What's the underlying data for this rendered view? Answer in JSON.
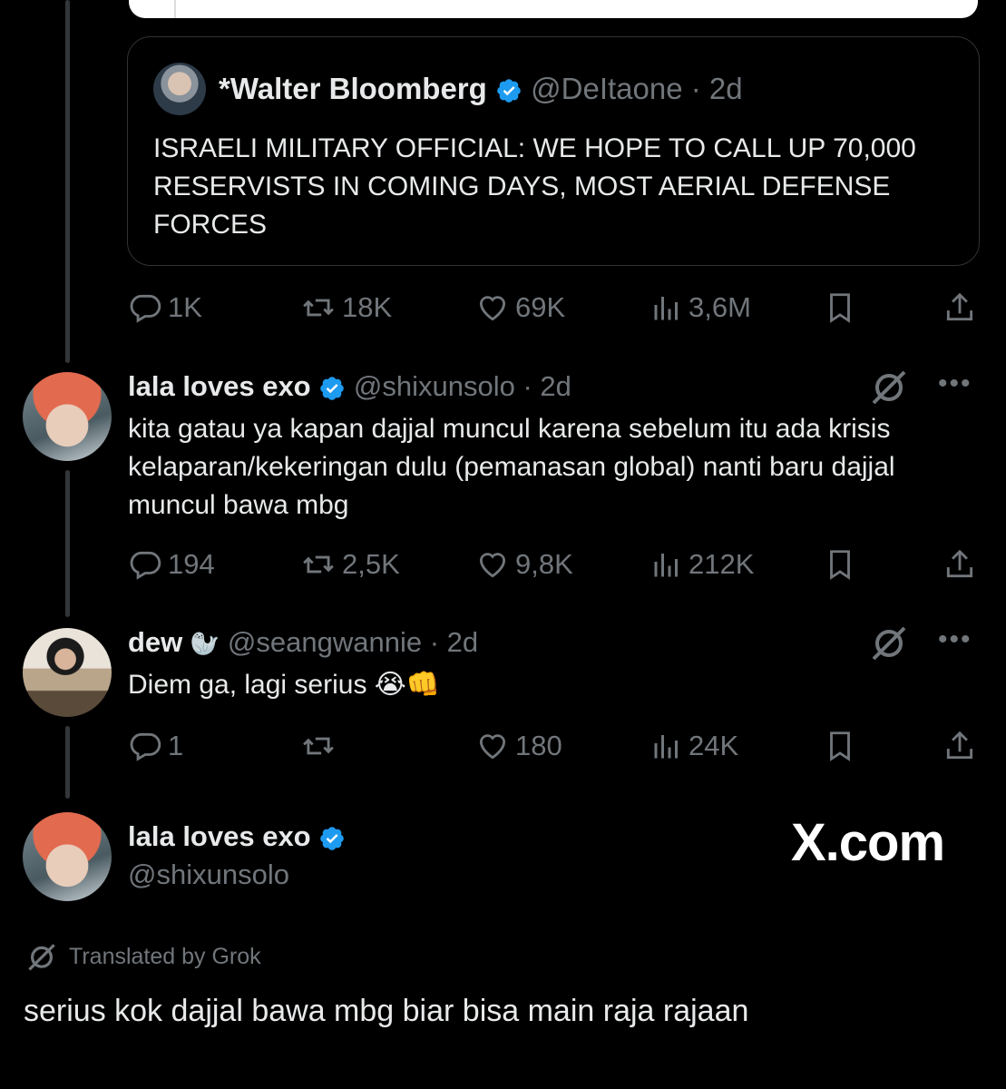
{
  "quoted_tweet": {
    "author_name": "*Walter Bloomberg",
    "handle": "@DeItaone",
    "time": "· 2d",
    "text": "ISRAELI MILITARY OFFICIAL: WE HOPE TO CALL UP 70,000 RESERVISTS IN COMING DAYS, MOST AERIAL DEFENSE FORCES"
  },
  "tweet1_actions": {
    "replies": "1K",
    "reposts": "18K",
    "likes": "69K",
    "views": "3,6M"
  },
  "tweet2": {
    "author_name": "lala loves exo",
    "handle": "@shixunsolo",
    "time": "· 2d",
    "text": "kita gatau ya kapan dajjal muncul karena sebelum itu ada krisis kelaparan/kekeringan dulu (pemanasan global) nanti baru dajjal muncul bawa mbg",
    "replies": "194",
    "reposts": "2,5K",
    "likes": "9,8K",
    "views": "212K"
  },
  "tweet3": {
    "author_name": "dew",
    "author_emoji": "🦭",
    "handle": "@seangwannie",
    "time": "· 2d",
    "text": "Diem ga, lagi serius 😭👊",
    "replies": "1",
    "reposts": "",
    "likes": "180",
    "views": "24K"
  },
  "focused_tweet": {
    "author_name": "lala loves exo",
    "handle": "@shixunsolo",
    "translated_label": "Translated by Grok",
    "text": "serius kok dajjal bawa mbg biar bisa main raja rajaan"
  },
  "watermark": "X.com",
  "colors": {
    "background": "#000000",
    "text": "#e7e9ea",
    "muted": "#71767b",
    "verified": "#1d9bf0",
    "border": "#2f3336"
  },
  "icons": [
    "reply-icon",
    "repost-icon",
    "like-icon",
    "views-icon",
    "bookmark-icon",
    "share-icon",
    "grok-icon",
    "more-icon",
    "verified-badge-icon"
  ]
}
